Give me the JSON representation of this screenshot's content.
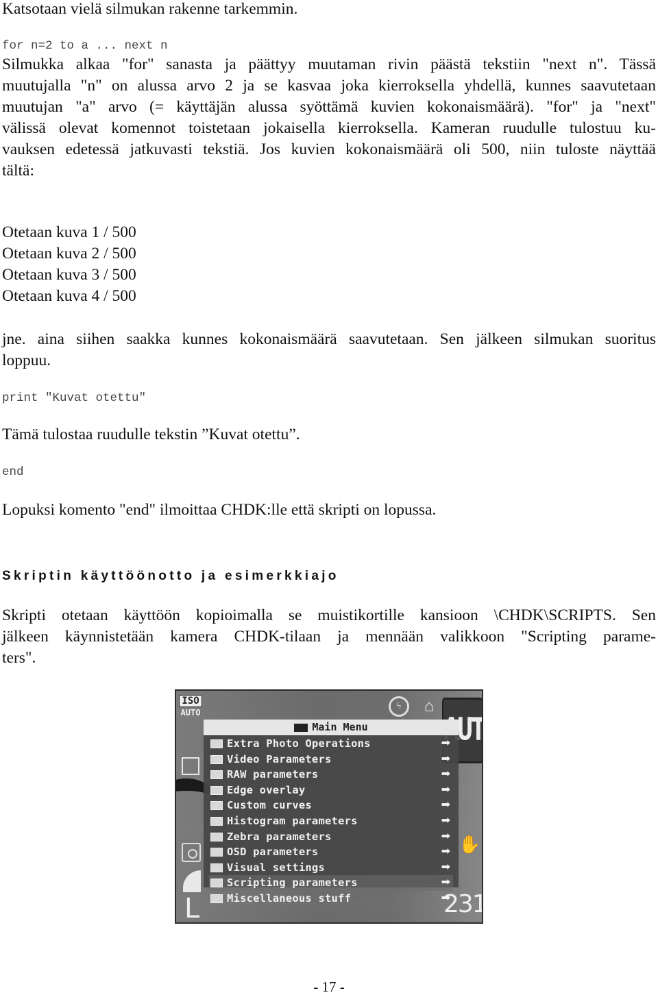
{
  "intro": "Katsotaan vielä silmukan rakenne tarkemmin.",
  "code_for": "for n=2 to a ... next n",
  "para_loop_lines": [
    "Silmukka alkaa \"for\" sanasta ja päättyy muutaman rivin päästä tekstiin \"next n\". Tässä",
    "muutujalla \"n\" on alussa arvo 2 ja se kasvaa joka kierroksella yhdellä, kunnes saavutetaan",
    "muutujan \"a\" arvo (= käyttäjän alussa syöttämä kuvien kokonaismäärä). \"for\" ja \"next\"",
    "välissä olevat komennot toistetaan jokaisella kierroksella. Kameran ruudulle tulostuu ku-",
    "vauksen edetessä jatkuvasti tekstiä. Jos kuvien kokonaismäärä oli 500, niin tuloste näyttää",
    "tältä:"
  ],
  "output_lines": [
    "Otetaan kuva 1 / 500",
    "Otetaan kuva 2 / 500",
    "Otetaan kuva 3 / 500",
    "Otetaan kuva 4 / 500"
  ],
  "para_etc_lines": [
    "jne. aina siihen saakka kunnes kokonaismäärä saavutetaan. Sen jälkeen silmukan suoritus",
    "loppuu."
  ],
  "code_print": "print \"Kuvat otettu\"",
  "para_print": "Tämä tulostaa ruudulle tekstin ”Kuvat otettu”.",
  "code_end": "end",
  "para_end": "Lopuksi komento \"end\" ilmoittaa CHDK:lle että skripti on lopussa.",
  "section_heading": "Skriptin käyttöönotto ja esimerkkiajo",
  "para_usage_lines": [
    "Skripti otetaan käyttöön kopioimalla se muistikortille kansioon \\CHDK\\SCRIPTS. Sen",
    "jälkeen käynnistetään kamera CHDK-tilaan ja mennään valikkoon \"Scripting parame-",
    "ters\"."
  ],
  "camera_screen": {
    "iso_label": "ISO",
    "iso_value": "AUTO",
    "mode_badge": "AUTO",
    "menu_title": "Main Menu",
    "menu_items": [
      {
        "label": "Extra Photo Operations",
        "icon": "camera-icon"
      },
      {
        "label": "Video Parameters",
        "icon": "video-icon"
      },
      {
        "label": "RAW parameters",
        "icon": "raw-icon"
      },
      {
        "label": "Edge overlay",
        "icon": "edge-overlay-icon"
      },
      {
        "label": "Custom curves",
        "icon": "curve-icon"
      },
      {
        "label": "Histogram parameters",
        "icon": "histogram-icon"
      },
      {
        "label": "Zebra parameters",
        "icon": "zebra-icon"
      },
      {
        "label": "OSD parameters",
        "icon": "osd-icon"
      },
      {
        "label": "Visual settings",
        "icon": "visual-settings-icon"
      },
      {
        "label": "Scripting parameters",
        "icon": "scripting-icon"
      },
      {
        "label": "Miscellaneous stuff",
        "icon": "misc-icon"
      }
    ],
    "arrow_glyph": "➡",
    "image_size": "L",
    "shots_remaining": "231"
  },
  "page_number": "- 17 -"
}
